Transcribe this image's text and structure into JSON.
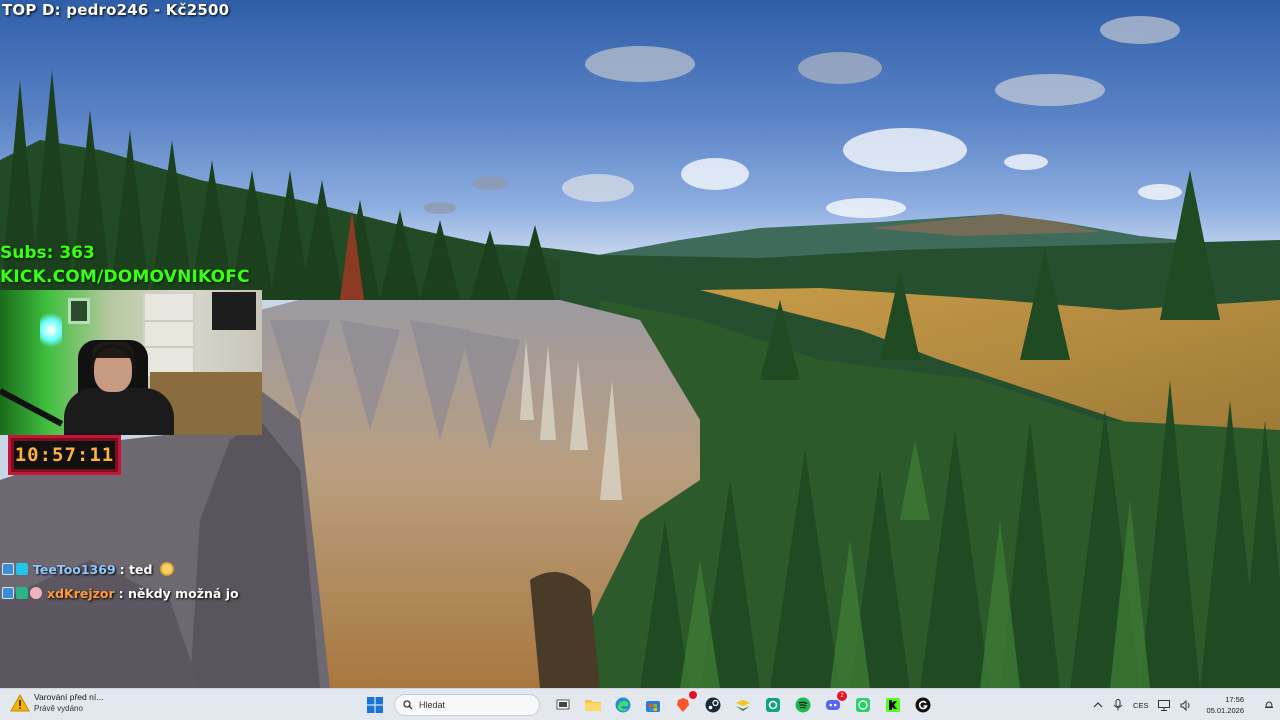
{
  "overlay": {
    "top_donation": "TOP D: pedro246 - Kč2500",
    "subs": "Subs: 363",
    "channel": "KICK.COM/DOMOVNIKOFC",
    "timer": "10:57:11"
  },
  "chat": [
    {
      "user": "TeeToo1369",
      "message": ": ted",
      "user_color": "#8ec8ff"
    },
    {
      "user": "xdKrejzor",
      "message": ": někdy možná jo",
      "user_color": "#ff9a3c"
    }
  ],
  "taskbar": {
    "notification": {
      "title": "Varování před ní...",
      "subtitle": "Právě vydáno"
    },
    "search_placeholder": "Hledat",
    "pinned_apps": [
      "windows-start",
      "search",
      "task-view",
      "file-explorer",
      "edge",
      "microsoft-store",
      "brave",
      "steam",
      "app-stack",
      "app-green",
      "spotify",
      "discord",
      "whatsapp",
      "kick",
      "other-app"
    ],
    "discord_badge": "2",
    "tray": {
      "language": "CES",
      "time": "17:56",
      "date": "05.01.2026"
    }
  }
}
